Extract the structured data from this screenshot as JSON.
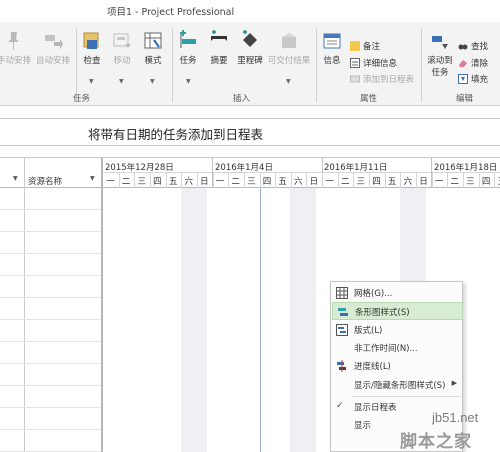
{
  "window": {
    "title": "项目1 - Project Professional"
  },
  "ribbon": {
    "buttons": {
      "manual": "手动安排",
      "auto": "自动安排",
      "inspect": "检查",
      "move": "移动",
      "mode": "模式",
      "task": "任务",
      "summary": "摘要",
      "milestone": "里程碑",
      "deliverable": "可交付结果",
      "info": "信息",
      "scroll_line1": "滚动到",
      "scroll_line2": "任务"
    },
    "small": {
      "notes": "备注",
      "details": "详细信息",
      "add_timeline": "添加到日程表",
      "find": "查找",
      "clear": "清除",
      "fill": "填充"
    },
    "groups": {
      "tasks": "任务",
      "insert": "插入",
      "properties": "属性",
      "editing": "编辑"
    }
  },
  "timeline": {
    "text": "将带有日期的任务添加到日程表"
  },
  "table": {
    "column_resource": "资源名称"
  },
  "gantt": {
    "weeks": [
      "2015年12月28日",
      "2016年1月4日",
      "2016年1月11日",
      "2016年1月18日"
    ],
    "days": [
      "一",
      "二",
      "三",
      "四",
      "五",
      "六",
      "日",
      "一",
      "二",
      "三",
      "四",
      "五",
      "六",
      "日",
      "一",
      "二",
      "三",
      "四",
      "五",
      "六",
      "日",
      "一",
      "二",
      "三",
      "四",
      "五"
    ]
  },
  "context_menu": {
    "items": [
      {
        "label": "网格(G)...",
        "icon": "grid-icon"
      },
      {
        "label": "条形图样式(S)",
        "icon": "bar-style-icon",
        "highlighted": true
      },
      {
        "label": "版式(L)",
        "icon": "layout-icon"
      },
      {
        "label": "非工作时间(N)...",
        "icon": ""
      },
      {
        "label": "进度线(L)",
        "icon": "progress-line-icon"
      },
      {
        "label": "显示/隐藏条形图样式(S)",
        "icon": "",
        "submenu": true
      },
      {
        "label": "显示日程表",
        "icon": "check-icon"
      },
      {
        "label": "显示",
        "icon": ""
      }
    ]
  },
  "watermark": {
    "site": "jb51.net",
    "name": "脚本之家"
  },
  "colors": {
    "highlight": "#d7ecd3",
    "nonwork": "#f0eff4",
    "ribbon_bg": "#f3f3f3"
  }
}
